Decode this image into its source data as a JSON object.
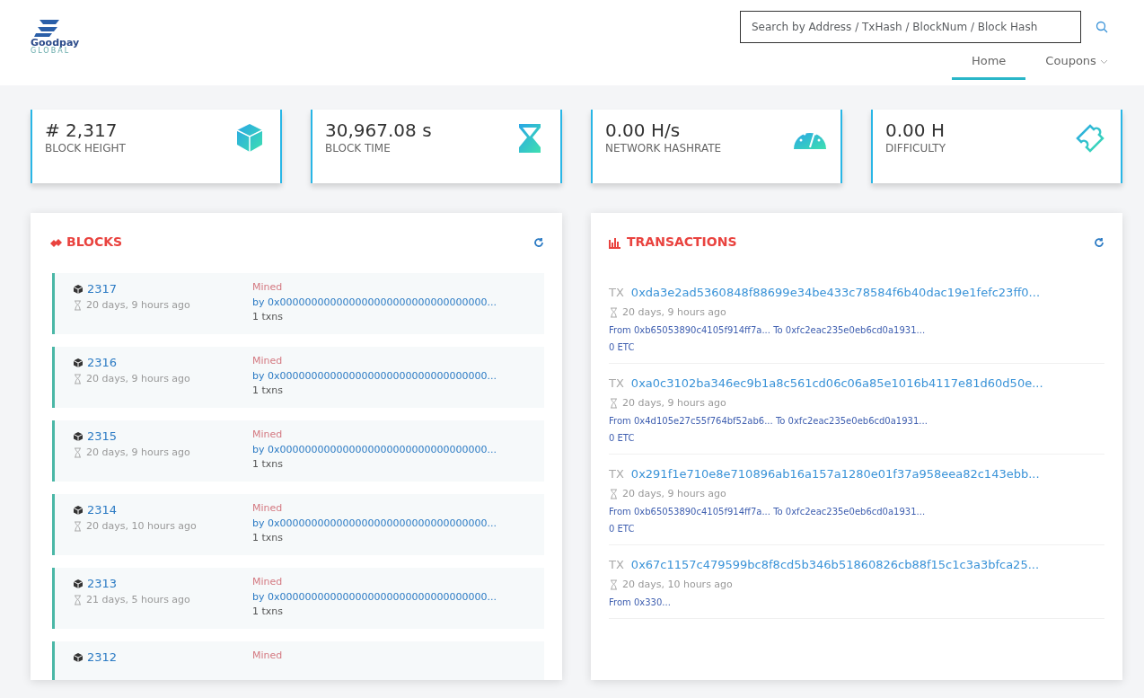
{
  "logo": {
    "text": "Goodpay",
    "subtext": "GLOBAL"
  },
  "search": {
    "placeholder": "Search by Address / TxHash / BlockNum / Block Hash"
  },
  "nav": [
    {
      "label": "Home",
      "selected": true,
      "dropdown": false
    },
    {
      "label": "Coupons",
      "selected": false,
      "dropdown": true
    }
  ],
  "stats": [
    {
      "kind": "cube",
      "value": "# 2,317",
      "label": "BLOCK HEIGHT"
    },
    {
      "kind": "hourglass",
      "value": "30,967.08 s",
      "label": "BLOCK TIME"
    },
    {
      "kind": "gauge",
      "value": "0.00 H/s",
      "label": "NETWORK HASHRATE"
    },
    {
      "kind": "puzzle",
      "value": "0.00 H",
      "label": "DIFFICULTY"
    }
  ],
  "blocks": {
    "title": "BLOCKS",
    "items": [
      {
        "number": "2317",
        "age": "20 days, 9 hours ago",
        "mined": "Mined",
        "miner": "by 0x000000000000000000000000000000000...",
        "txns": "1 txns"
      },
      {
        "number": "2316",
        "age": "20 days, 9 hours ago",
        "mined": "Mined",
        "miner": "by 0x000000000000000000000000000000000...",
        "txns": "1 txns"
      },
      {
        "number": "2315",
        "age": "20 days, 9 hours ago",
        "mined": "Mined",
        "miner": "by 0x000000000000000000000000000000000...",
        "txns": "1 txns"
      },
      {
        "number": "2314",
        "age": "20 days, 10 hours ago",
        "mined": "Mined",
        "miner": "by 0x000000000000000000000000000000000...",
        "txns": "1 txns"
      },
      {
        "number": "2313",
        "age": "21 days, 5 hours ago",
        "mined": "Mined",
        "miner": "by 0x000000000000000000000000000000000...",
        "txns": "1 txns"
      },
      {
        "number": "2312",
        "mined": "Mined"
      }
    ]
  },
  "transactions": {
    "title": "TRANSACTIONS",
    "items": [
      {
        "prefix": "TX",
        "hash": "0xda3e2ad5360848f88699e34be433c78584f6b40dac19e1fefc23ff0...",
        "age": "20 days, 9 hours ago",
        "route": "From 0xb65053890c4105f914ff7a... To 0xfc2eac235e0eb6cd0a1931...",
        "amount": "0 ETC"
      },
      {
        "prefix": "TX",
        "hash": "0xa0c3102ba346ec9b1a8c561cd06c06a85e1016b4117e81d60d50e...",
        "age": "20 days, 9 hours ago",
        "route": "From 0x4d105e27c55f764bf52ab6... To 0xfc2eac235e0eb6cd0a1931...",
        "amount": "0 ETC"
      },
      {
        "prefix": "TX",
        "hash": "0x291f1e710e8e710896ab16a157a1280e01f37a958eea82c143ebb...",
        "age": "20 days, 9 hours ago",
        "route": "From 0xb65053890c4105f914ff7a... To 0xfc2eac235e0eb6cd0a1931...",
        "amount": "0 ETC"
      },
      {
        "prefix": "TX",
        "hash": "0x67c1157c479599bc8f8cd5b346b51860826cb88f15c1c3a3bfca25...",
        "age": "20 days, 10 hours ago",
        "route": "From 0x330..."
      }
    ]
  }
}
